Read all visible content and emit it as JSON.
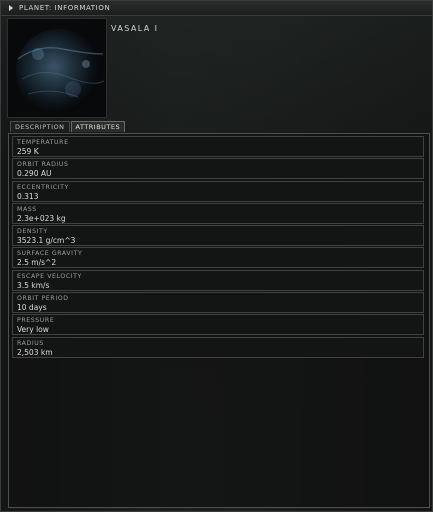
{
  "window": {
    "title": "PLANET: INFORMATION"
  },
  "planet": {
    "name": "VASALA I"
  },
  "tabs": [
    {
      "label": "DESCRIPTION",
      "active": false
    },
    {
      "label": "ATTRIBUTES",
      "active": true
    }
  ],
  "attributes": [
    {
      "label": "TEMPERATURE",
      "value": "259 K"
    },
    {
      "label": "ORBIT RADIUS",
      "value": "0.290 AU"
    },
    {
      "label": "ECCENTRICITY",
      "value": "0.313"
    },
    {
      "label": "MASS",
      "value": "2.3e+023 kg"
    },
    {
      "label": "DENSITY",
      "value": "3523.1 g/cm^3"
    },
    {
      "label": "SURFACE GRAVITY",
      "value": "2.5 m/s^2"
    },
    {
      "label": "ESCAPE VELOCITY",
      "value": "3.5 km/s"
    },
    {
      "label": "ORBIT PERIOD",
      "value": "10 days"
    },
    {
      "label": "PRESSURE",
      "value": "Very low"
    },
    {
      "label": "RADIUS",
      "value": "2,503 km"
    }
  ]
}
